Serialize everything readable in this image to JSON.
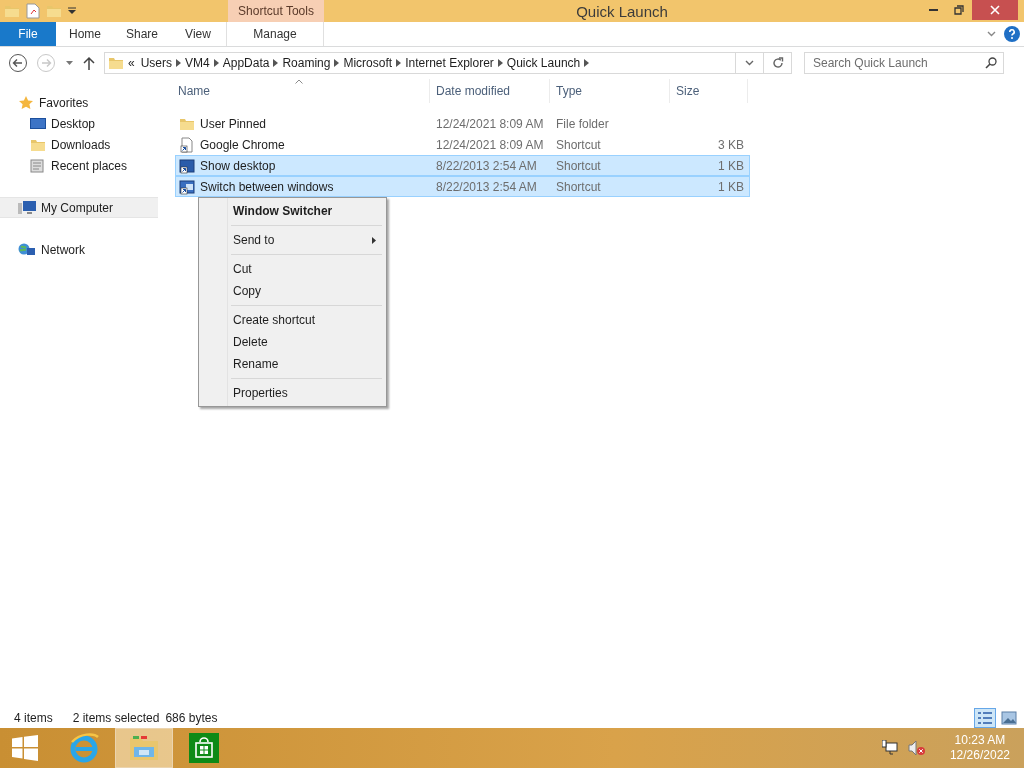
{
  "window": {
    "title": "Quick Launch",
    "contextual_group": "Shortcut Tools"
  },
  "ribbon_tabs": [
    {
      "label": "File",
      "kind": "file",
      "selected": false
    },
    {
      "label": "Home",
      "kind": "normal",
      "selected": false
    },
    {
      "label": "Share",
      "kind": "normal",
      "selected": false
    },
    {
      "label": "View",
      "kind": "normal",
      "selected": false
    },
    {
      "label": "Manage",
      "kind": "contextual",
      "selected": false
    }
  ],
  "address_bar": {
    "overflow": "«",
    "segments": [
      "Users",
      "VM4",
      "AppData",
      "Roaming",
      "Microsoft",
      "Internet Explorer",
      "Quick Launch"
    ]
  },
  "search": {
    "placeholder": "Search Quick Launch"
  },
  "navigation": [
    {
      "label": "Favorites",
      "kind": "favorites",
      "selected": false,
      "children": [
        {
          "label": "Desktop",
          "kind": "desktop",
          "selected": false
        },
        {
          "label": "Downloads",
          "kind": "downloads",
          "selected": false
        },
        {
          "label": "Recent places",
          "kind": "recent",
          "selected": false
        }
      ]
    },
    {
      "label": "My Computer",
      "kind": "computer",
      "selected": true
    },
    {
      "label": "Network",
      "kind": "network",
      "selected": false
    }
  ],
  "columns": [
    {
      "label": "Name",
      "sorted": true
    },
    {
      "label": "Date modified",
      "sorted": false
    },
    {
      "label": "Type",
      "sorted": false
    },
    {
      "label": "Size",
      "sorted": false
    }
  ],
  "files": [
    {
      "name": "User Pinned",
      "date": "12/24/2021 8:09 AM",
      "type": "File folder",
      "kind": "folder",
      "selected": false
    },
    {
      "name": "Google Chrome",
      "date": "12/24/2021 8:09 AM",
      "type": "Shortcut",
      "size": "3 KB",
      "kind": "shortcut",
      "selected": false
    },
    {
      "name": "Show desktop",
      "date": "8/22/2013 2:54 AM",
      "type": "Shortcut",
      "size": "1 KB",
      "kind": "desktop-shortcut",
      "selected": true
    },
    {
      "name": "Switch between windows",
      "date": "8/22/2013 2:54 AM",
      "type": "Shortcut",
      "size": "1 KB",
      "kind": "window-shortcut",
      "selected": true
    }
  ],
  "context_menu": {
    "groups": [
      [
        {
          "label": "Window Switcher",
          "kind": "default"
        }
      ],
      [
        {
          "label": "Send to",
          "kind": "submenu"
        }
      ],
      [
        {
          "label": "Cut",
          "kind": "item"
        },
        {
          "label": "Copy",
          "kind": "item"
        }
      ],
      [
        {
          "label": "Create shortcut",
          "kind": "item"
        },
        {
          "label": "Delete",
          "kind": "item"
        },
        {
          "label": "Rename",
          "kind": "item"
        }
      ],
      [
        {
          "label": "Properties",
          "kind": "item"
        }
      ]
    ]
  },
  "status_bar": {
    "item_count": "4 items",
    "selection": "2 items selected",
    "selection_size": "686 bytes",
    "views": [
      {
        "kind": "details",
        "selected": true
      },
      {
        "kind": "thumbnails",
        "selected": false
      }
    ]
  },
  "taskbar": {
    "apps": [
      {
        "kind": "browser",
        "active": false
      },
      {
        "kind": "explorer",
        "active": true
      },
      {
        "kind": "store",
        "active": false
      }
    ],
    "volume_muted": true,
    "time": "10:23 AM",
    "date": "12/26/2022"
  }
}
